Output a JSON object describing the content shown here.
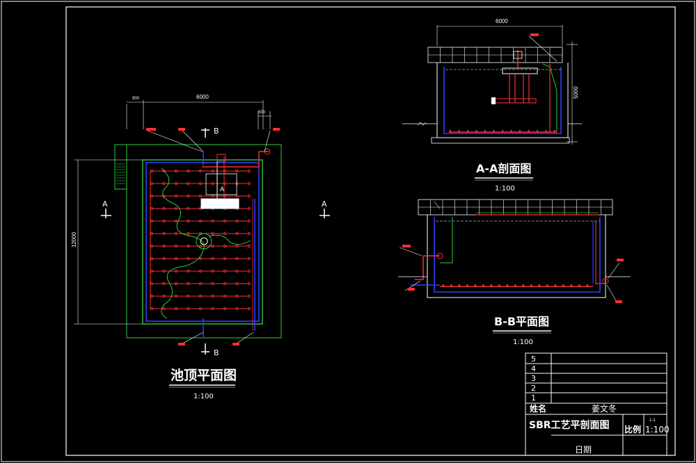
{
  "drawing": {
    "plan": {
      "title": "池顶平面图",
      "scale": "1:100",
      "dim_top_small": "900",
      "dim_top": "6000",
      "dim_right_small": "500",
      "dim_left": "12000",
      "section_a": "A",
      "section_b": "B",
      "center_label": "A"
    },
    "section_aa": {
      "title": "A-A剖面图",
      "scale": "1:100",
      "dim_top": "6000",
      "dim_right": "5000"
    },
    "section_bb": {
      "title": "B-B平面图",
      "scale": "1:100"
    }
  },
  "title_block": {
    "rows": [
      "5",
      "4",
      "3",
      "2",
      "1"
    ],
    "name_label": "姓名",
    "name_value": "姜文冬",
    "drawing_title": "SBR工艺平剖面图",
    "scale_label": "比例",
    "scale_value": "1:100",
    "sheet_no": "1-1",
    "date_label": "日期"
  },
  "colors": {
    "frame": "#ffffff",
    "wall_green": "#2ecc40",
    "pipe_red": "#ff3030",
    "pipe_blue": "#3040ff",
    "hatch_white": "#ffffff"
  }
}
